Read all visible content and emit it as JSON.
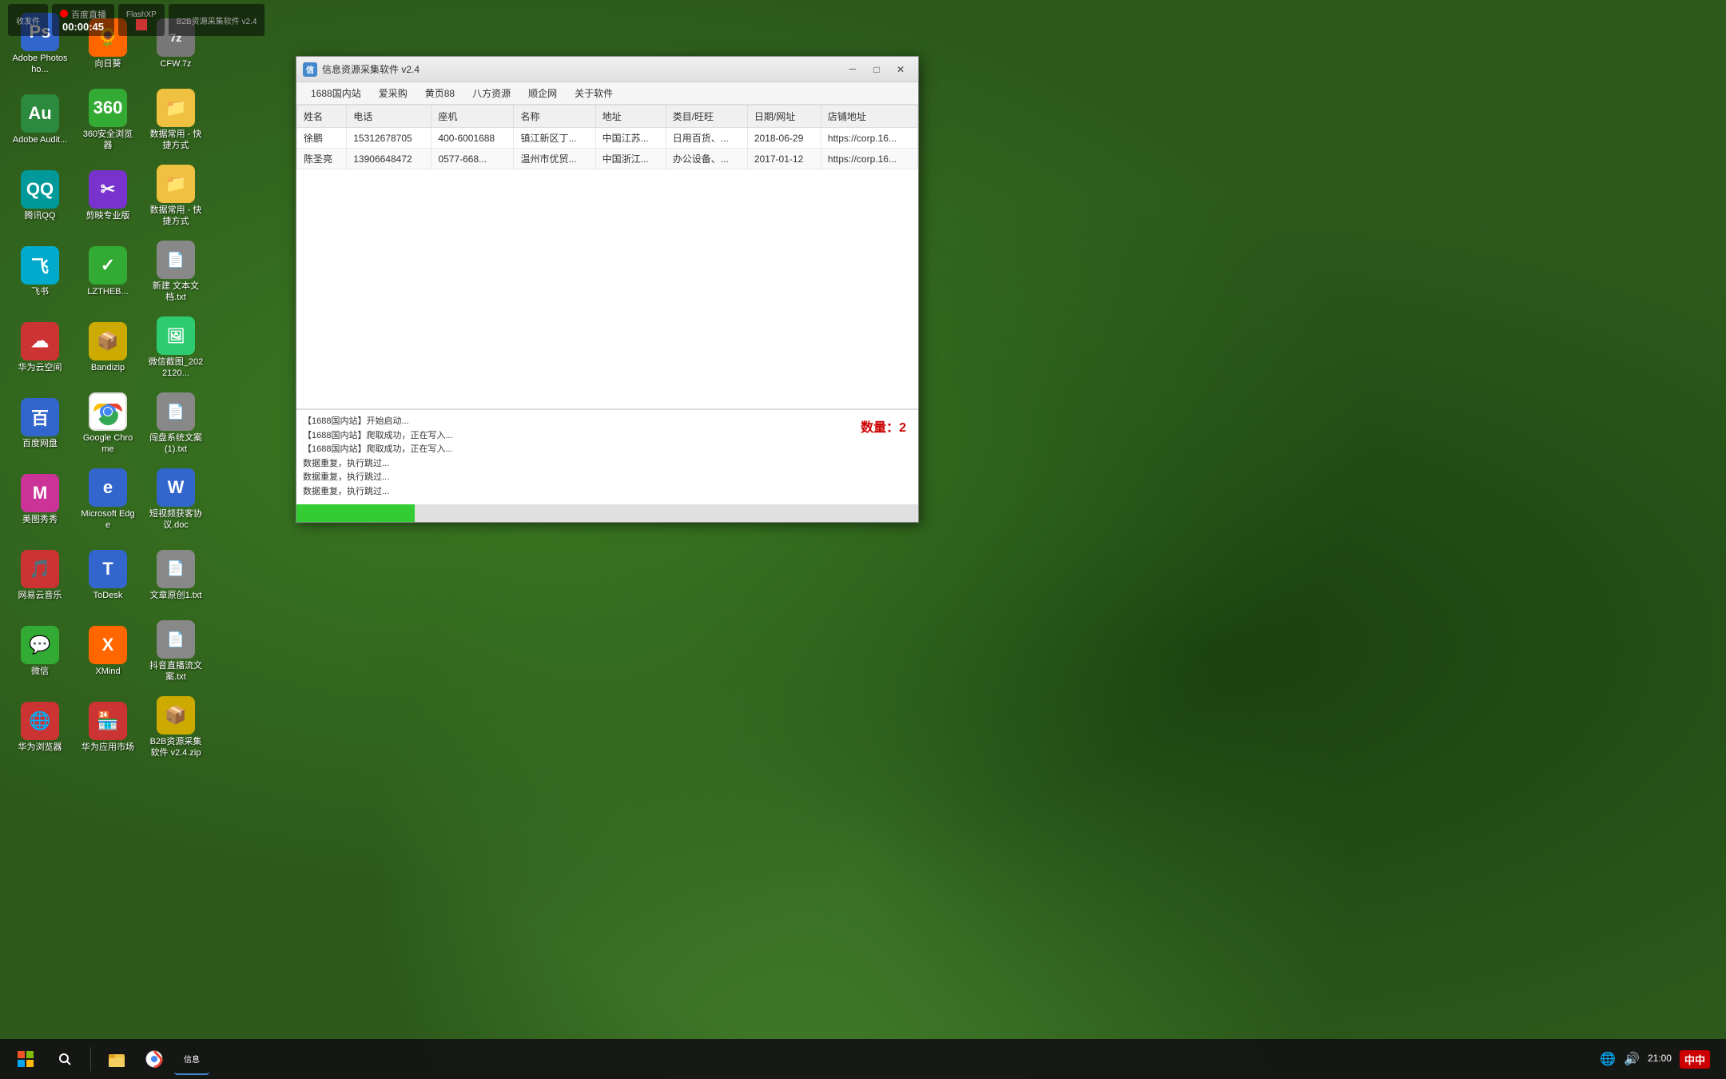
{
  "desktop": {
    "background": "#2d5a1b"
  },
  "top_bar": {
    "items": [
      {
        "title": "收发件",
        "value": ""
      },
      {
        "title": "百度直播",
        "value": "00:00:45"
      },
      {
        "title": "FlashXP",
        "value": ""
      },
      {
        "title": "B2B资源采集软件 v2.4",
        "value": ""
      }
    ]
  },
  "desktop_icons": [
    {
      "id": "adobe-ps",
      "label": "Adobe\nPhotosho...",
      "color": "ic-blue",
      "symbol": "Ps"
    },
    {
      "id": "xiangjiku",
      "label": "向日葵",
      "color": "ic-orange",
      "symbol": "🌻"
    },
    {
      "id": "cfz7",
      "label": "CFW.7z",
      "color": "ic-gray",
      "symbol": "7z"
    },
    {
      "id": "adobe-au",
      "label": "Adobe\nAudit...",
      "color": "ic-green",
      "symbol": "Au"
    },
    {
      "id": "360browser",
      "label": "360安全浏览器",
      "color": "ic-green",
      "symbol": "🛡"
    },
    {
      "id": "folder1",
      "label": "数据常用 - 快捷方式",
      "color": "ic-folder",
      "symbol": "📁"
    },
    {
      "id": "tencent-qq",
      "label": "腾讯QQ",
      "color": "ic-pink",
      "symbol": "🐧"
    },
    {
      "id": "jianying",
      "label": "剪映专业版",
      "color": "ic-purple",
      "symbol": "✂"
    },
    {
      "id": "shuju",
      "label": "数据常用 - 快捷方式",
      "color": "ic-folder",
      "symbol": "📁"
    },
    {
      "id": "feishu",
      "label": "飞书",
      "color": "ic-cyan",
      "symbol": "飞"
    },
    {
      "id": "lztheb",
      "label": "LZTHEB...",
      "color": "ic-green",
      "symbol": "✓"
    },
    {
      "id": "textfile",
      "label": "新建 文本文档.txt",
      "color": "ic-gray",
      "symbol": "📄"
    },
    {
      "id": "huawei-cloud",
      "label": "华为云空间",
      "color": "ic-red",
      "symbol": "☁"
    },
    {
      "id": "bandizip",
      "label": "Bandizip",
      "color": "ic-yellow",
      "symbol": "📦"
    },
    {
      "id": "wechat-img",
      "label": "微信截图\n_2022120...",
      "color": "ic-green",
      "symbol": "🖼"
    },
    {
      "id": "baidu-pan",
      "label": "百度网盘",
      "color": "ic-blue",
      "symbol": "☁"
    },
    {
      "id": "google-chrome",
      "label": "Google\nChrome",
      "color": "ic-red",
      "symbol": "🔵"
    },
    {
      "id": "wenjian",
      "label": "闯盘系统文案(1).txt",
      "color": "ic-gray",
      "symbol": "📄"
    },
    {
      "id": "meitushow",
      "label": "美图秀秀",
      "color": "ic-pink",
      "symbol": "M"
    },
    {
      "id": "ms-edge",
      "label": "Microsoft\nEdge",
      "color": "ic-blue",
      "symbol": "e"
    },
    {
      "id": "short-video",
      "label": "短视频获客协议.doc",
      "color": "ic-blue",
      "symbol": "W"
    },
    {
      "id": "wangyi-music",
      "label": "网易云音乐",
      "color": "ic-red",
      "symbol": "🎵"
    },
    {
      "id": "todesk",
      "label": "ToDesk",
      "color": "ic-blue",
      "symbol": "T"
    },
    {
      "id": "wenzhang",
      "label": "文章原创1.txt",
      "color": "ic-gray",
      "symbol": "📄"
    },
    {
      "id": "wechat",
      "label": "微信",
      "color": "ic-green",
      "symbol": "💬"
    },
    {
      "id": "xmind",
      "label": "XMind",
      "color": "ic-orange",
      "symbol": "X"
    },
    {
      "id": "douyin-live",
      "label": "抖音直播流文案.txt",
      "color": "ic-gray",
      "symbol": "📄"
    },
    {
      "id": "huawei-browser",
      "label": "华为浏览器",
      "color": "ic-red",
      "symbol": "🌐"
    },
    {
      "id": "huawei-appstore",
      "label": "华为应用市场",
      "color": "ic-red",
      "symbol": "🏪"
    },
    {
      "id": "b2b-zip",
      "label": "B2B资源采集软件 v2.4.zip",
      "color": "ic-yellow",
      "symbol": "📦"
    }
  ],
  "window": {
    "title": "信息资源采集软件 v2.4",
    "menu_items": [
      "1688国内站",
      "爱采购",
      "黄页88",
      "八方资源",
      "顺企网",
      "关于软件"
    ],
    "table": {
      "headers": [
        "姓名",
        "电话",
        "座机",
        "名称",
        "地址",
        "类目/旺旺",
        "日期/网址",
        "店铺地址"
      ],
      "rows": [
        {
          "name": "徐鹏",
          "phone": "15312678705",
          "landline": "400-6001688",
          "shop_name": "镇江新区丁...",
          "address": "中国江苏...",
          "category": "日用百货、...",
          "date": "2018-06-29",
          "store_url": "https://corp.16..."
        },
        {
          "name": "陈圣亮",
          "phone": "13906648472",
          "landline": "0577-668...",
          "shop_name": "温州市优贸...",
          "address": "中国浙江...",
          "category": "办公设备、...",
          "date": "2017-01-12",
          "store_url": "https://corp.16..."
        }
      ]
    },
    "log_lines": [
      "【1688国内站】开始启动...",
      "【1688国内站】爬取成功，正在写入...",
      "【1688国内站】爬取成功，正在写入...",
      "数据重复，执行跳过...",
      "数据重复，执行跳过...",
      "数据重复，执行跳过..."
    ],
    "count_label": "数量：2",
    "progress_percent": 19
  },
  "taskbar": {
    "time": "21:00",
    "date": "",
    "ime": "中"
  }
}
